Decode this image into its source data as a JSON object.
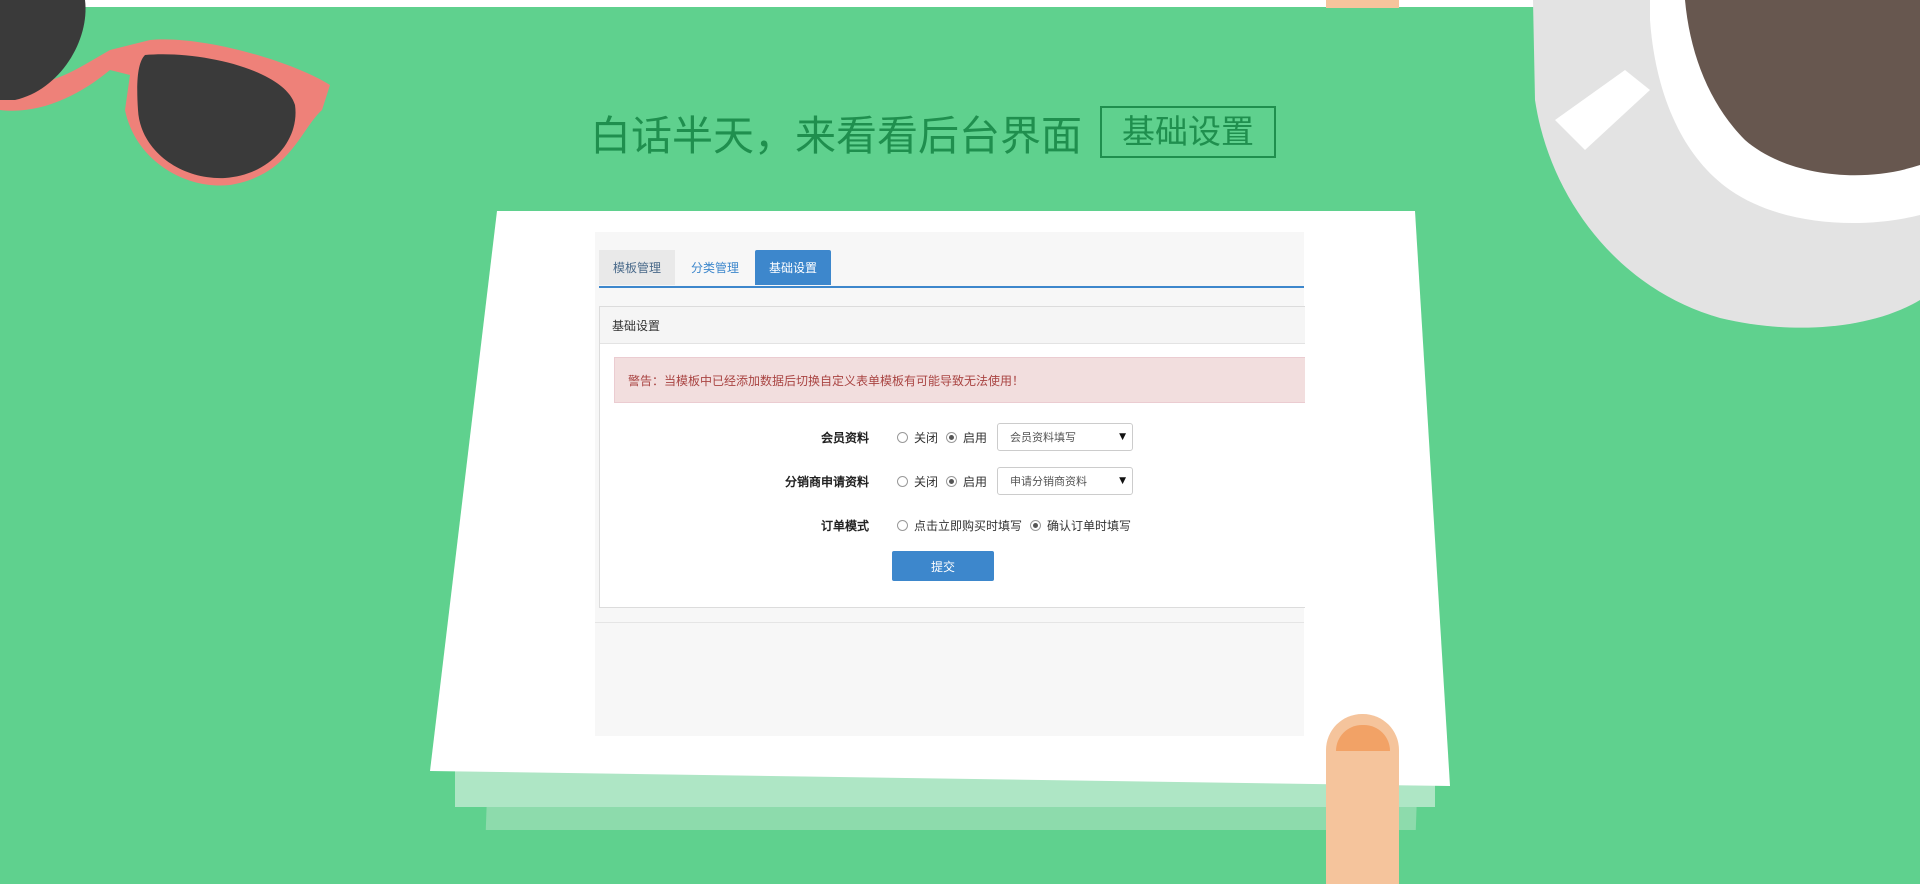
{
  "headline": {
    "text": "白话半天，来看看后台界面",
    "tag": "基础设置"
  },
  "app": {
    "tabs": [
      {
        "label": "模板管理"
      },
      {
        "label": "分类管理"
      },
      {
        "label": "基础设置",
        "active": true
      }
    ],
    "panel_title": "基础设置",
    "alert": "警告：当模板中已经添加数据后切换自定义表单模板有可能导致无法使用！",
    "rows": [
      {
        "label": "会员资料",
        "opt1": "关闭",
        "opt2": "启用",
        "selected": 2,
        "select": "会员资料填写"
      },
      {
        "label": "分销商申请资料",
        "opt1": "关闭",
        "opt2": "启用",
        "selected": 2,
        "select": "申请分销商资料"
      },
      {
        "label": "订单模式",
        "opt1": "点击立即购买时填写",
        "opt2": "确认订单时填写",
        "selected": 2
      }
    ],
    "submit": "提交"
  },
  "colors": {
    "background": "#5fd18e",
    "headline": "#1f8f4e",
    "primary": "#3d87cc",
    "alert_bg": "#f2dede",
    "alert_text": "#a94442"
  },
  "decorations": [
    "sunglasses-icon",
    "coffee-cup-icon",
    "finger-icon"
  ]
}
